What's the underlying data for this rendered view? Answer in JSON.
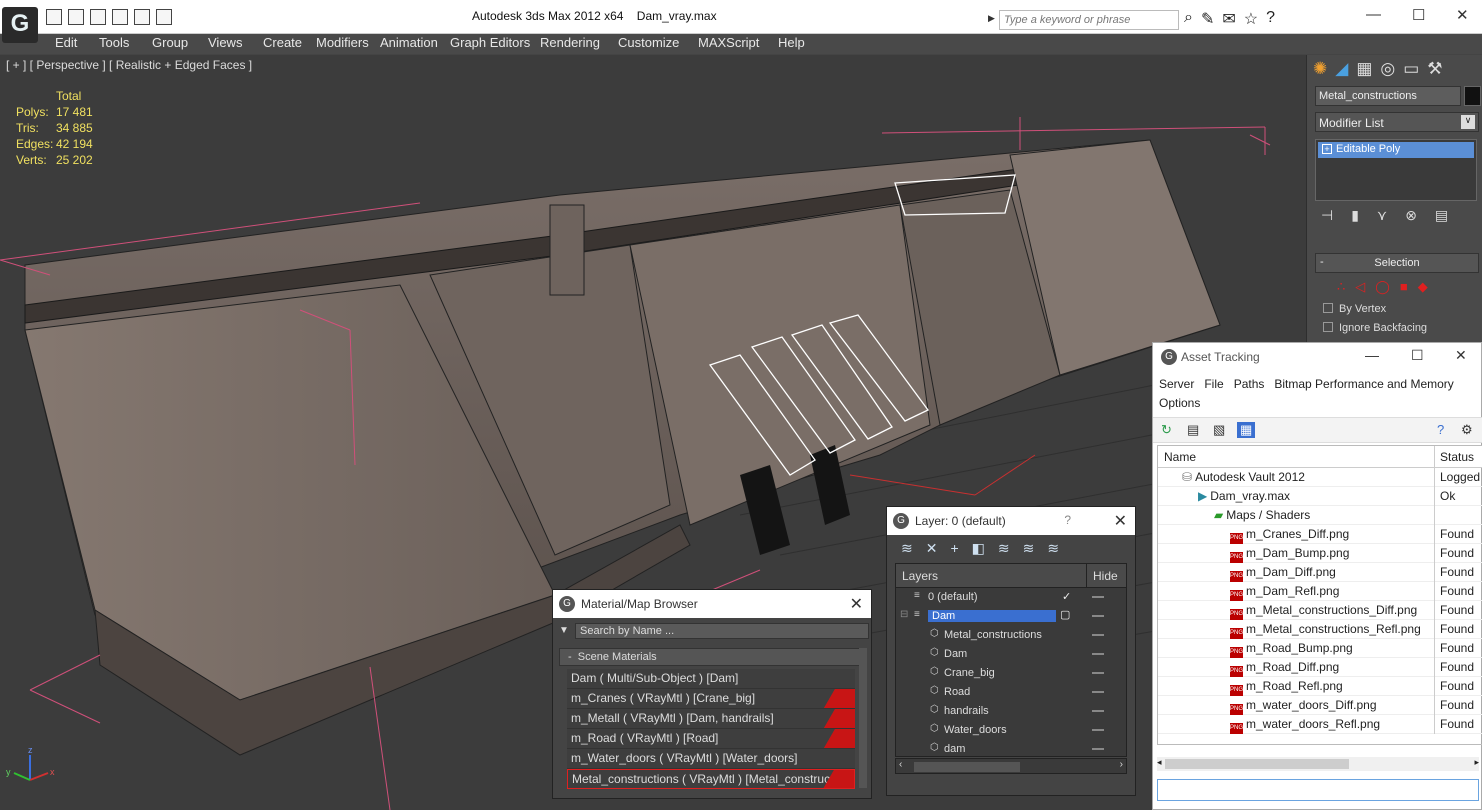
{
  "titlebar": {
    "app": "Autodesk 3ds Max  2012 x64",
    "file": "Dam_vray.max",
    "search_placeholder": "Type a keyword or phrase"
  },
  "menu": [
    "Edit",
    "Tools",
    "Group",
    "Views",
    "Create",
    "Modifiers",
    "Animation",
    "Graph Editors",
    "Rendering",
    "Customize",
    "MAXScript",
    "Help"
  ],
  "viewport": {
    "label": "[ + ] [ Perspective ] [ Realistic + Edged Faces ]",
    "stats": {
      "header": "Total",
      "rows": [
        {
          "k": "Polys:",
          "v": "17 481"
        },
        {
          "k": "Tris:",
          "v": "34 885"
        },
        {
          "k": "Edges:",
          "v": "42 194"
        },
        {
          "k": "Verts:",
          "v": "25 202"
        }
      ]
    },
    "axis": {
      "z": "z",
      "x": "x",
      "y": "y"
    }
  },
  "command_panel": {
    "object_name": "Metal_constructions",
    "modifier_list": "Modifier List",
    "stack_item": "Editable Poly",
    "rollout": "Selection",
    "by_vertex": "By Vertex",
    "ignore_backfacing": "Ignore Backfacing"
  },
  "material_browser": {
    "title": "Material/Map Browser",
    "search": "Search by Name ...",
    "group": "Scene Materials",
    "items": [
      {
        "label": "Dam  ( Multi/Sub-Object )  [Dam]",
        "red": false
      },
      {
        "label": "m_Cranes  ( VRayMtl )  [Crane_big]",
        "red": true
      },
      {
        "label": "m_Metall  ( VRayMtl )  [Dam, handrails]",
        "red": true
      },
      {
        "label": "m_Road  ( VRayMtl )  [Road]",
        "red": true
      },
      {
        "label": "m_Water_doors  ( VRayMtl )  [Water_doors]",
        "red": false
      },
      {
        "label": "Metal_constructions  ( VRayMtl )  [Metal_constructions]",
        "red": true
      }
    ]
  },
  "layer_window": {
    "title": "Layer: 0 (default)",
    "help": "?",
    "col_layers": "Layers",
    "col_hide": "Hide",
    "rows": [
      {
        "name": "0 (default)",
        "indent": 0,
        "check": true,
        "sel": false
      },
      {
        "name": "Dam",
        "indent": 0,
        "check": false,
        "sel": true
      },
      {
        "name": "Metal_constructions",
        "indent": 1,
        "check": false,
        "sel": false
      },
      {
        "name": "Dam",
        "indent": 1,
        "check": false,
        "sel": false
      },
      {
        "name": "Crane_big",
        "indent": 1,
        "check": false,
        "sel": false
      },
      {
        "name": "Road",
        "indent": 1,
        "check": false,
        "sel": false
      },
      {
        "name": "handrails",
        "indent": 1,
        "check": false,
        "sel": false
      },
      {
        "name": "Water_doors",
        "indent": 1,
        "check": false,
        "sel": false
      },
      {
        "name": "dam",
        "indent": 1,
        "check": false,
        "sel": false
      }
    ]
  },
  "asset_tracking": {
    "title": "Asset Tracking",
    "menu": [
      "Server",
      "File",
      "Paths",
      "Bitmap Performance and Memory",
      "Options"
    ],
    "col_name": "Name",
    "col_status": "Status",
    "rows": [
      {
        "name": "Autodesk Vault 2012",
        "status": "Logged",
        "level": 0,
        "type": "vault"
      },
      {
        "name": "Dam_vray.max",
        "status": "Ok",
        "level": 1,
        "type": "max"
      },
      {
        "name": "Maps / Shaders",
        "status": "",
        "level": 2,
        "type": "folder"
      },
      {
        "name": "m_Cranes_Diff.png",
        "status": "Found",
        "level": 3,
        "type": "png"
      },
      {
        "name": "m_Dam_Bump.png",
        "status": "Found",
        "level": 3,
        "type": "png"
      },
      {
        "name": "m_Dam_Diff.png",
        "status": "Found",
        "level": 3,
        "type": "png"
      },
      {
        "name": "m_Dam_Refl.png",
        "status": "Found",
        "level": 3,
        "type": "png"
      },
      {
        "name": "m_Metal_constructions_Diff.png",
        "status": "Found",
        "level": 3,
        "type": "png"
      },
      {
        "name": "m_Metal_constructions_Refl.png",
        "status": "Found",
        "level": 3,
        "type": "png"
      },
      {
        "name": "m_Road_Bump.png",
        "status": "Found",
        "level": 3,
        "type": "png"
      },
      {
        "name": "m_Road_Diff.png",
        "status": "Found",
        "level": 3,
        "type": "png"
      },
      {
        "name": "m_Road_Refl.png",
        "status": "Found",
        "level": 3,
        "type": "png"
      },
      {
        "name": "m_water_doors_Diff.png",
        "status": "Found",
        "level": 3,
        "type": "png"
      },
      {
        "name": "m_water_doors_Refl.png",
        "status": "Found",
        "level": 3,
        "type": "png"
      }
    ]
  }
}
